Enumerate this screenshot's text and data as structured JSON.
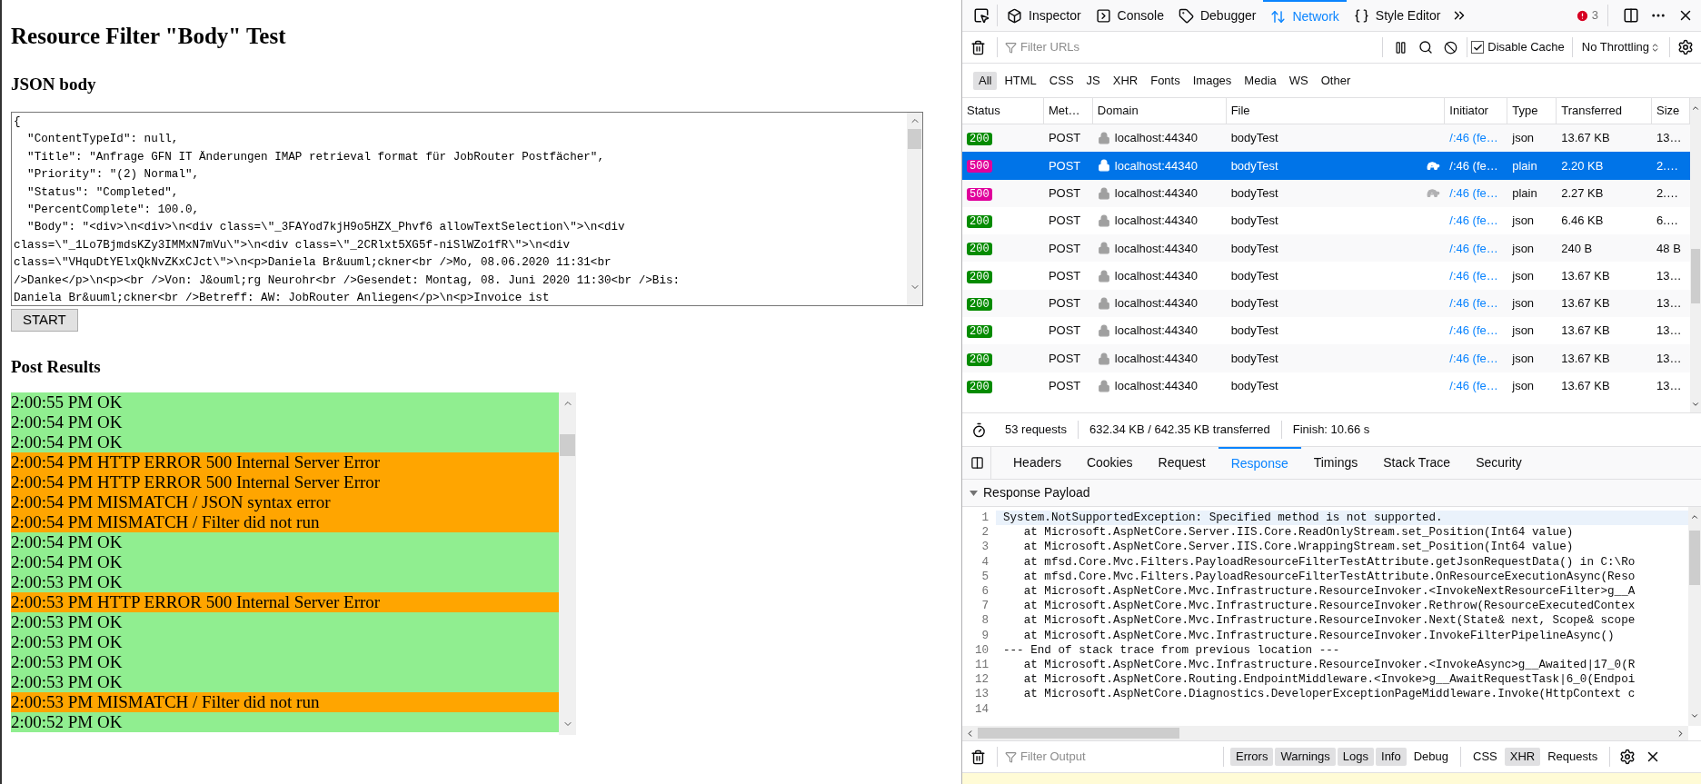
{
  "page": {
    "title": "Resource Filter \"Body\" Test",
    "body_heading": "JSON body",
    "json_body": [
      "{",
      "  \"ContentTypeId\": null,",
      "  \"Title\": \"Anfrage GFN IT Änderungen IMAP retrieval format für JobRouter Postfächer\",",
      "  \"Priority\": \"(2) Normal\",",
      "  \"Status\": \"Completed\",",
      "  \"PercentComplete\": 100.0,",
      "  \"Body\": \"<div>\\n<div>\\n<div class=\\\"_3FAYod7kjH9o5HZX_Phvf6 allowTextSelection\\\">\\n<div",
      "class=\\\"_1Lo7BjmdsKZy3IMMxN7mVu\\\">\\n<div class=\\\"_2CRlxt5XG5f-niSlWZo1fR\\\">\\n<div",
      "class=\\\"VHquDtYElxQkNvZKxCJct\\\">\\n<p>Daniela Br&uuml;ckner<br />Mo, 08.06.2020 11:31<br",
      "/>Danke</p>\\n<p><br />Von: J&ouml;rg Neurohr<br />Gesendet: Montag, 08. Juni 2020 11:30<br />Bis:",
      "Daniela Br&uuml;ckner<br />Betreff: AW: JobRouter Anliegen</p>\\n<p>Invoice ist"
    ],
    "start_button": "START",
    "results_heading": "Post Results",
    "results": [
      {
        "text": "2:00:55 PM OK",
        "kind": "ok"
      },
      {
        "text": "2:00:54 PM OK",
        "kind": "ok"
      },
      {
        "text": "2:00:54 PM OK",
        "kind": "ok"
      },
      {
        "text": "2:00:54 PM HTTP ERROR 500 Internal Server Error",
        "kind": "error"
      },
      {
        "text": "2:00:54 PM HTTP ERROR 500 Internal Server Error",
        "kind": "error"
      },
      {
        "text": "2:00:54 PM MISMATCH / JSON syntax error",
        "kind": "error"
      },
      {
        "text": "2:00:54 PM MISMATCH / Filter did not run",
        "kind": "error"
      },
      {
        "text": "2:00:54 PM OK",
        "kind": "ok"
      },
      {
        "text": "2:00:54 PM OK",
        "kind": "ok"
      },
      {
        "text": "2:00:53 PM OK",
        "kind": "ok"
      },
      {
        "text": "2:00:53 PM HTTP ERROR 500 Internal Server Error",
        "kind": "error"
      },
      {
        "text": "2:00:53 PM OK",
        "kind": "ok"
      },
      {
        "text": "2:00:53 PM OK",
        "kind": "ok"
      },
      {
        "text": "2:00:53 PM OK",
        "kind": "ok"
      },
      {
        "text": "2:00:53 PM OK",
        "kind": "ok"
      },
      {
        "text": "2:00:53 PM MISMATCH / Filter did not run",
        "kind": "error"
      },
      {
        "text": "2:00:52 PM OK",
        "kind": "ok"
      }
    ]
  },
  "devtools": {
    "tabs": [
      {
        "label": "Inspector",
        "kind": "inspector",
        "selected": false
      },
      {
        "label": "Console",
        "kind": "console",
        "selected": false
      },
      {
        "label": "Debugger",
        "kind": "debugger",
        "selected": false
      },
      {
        "label": "Network",
        "kind": "network",
        "selected": true
      },
      {
        "label": "Style Editor",
        "kind": "style",
        "selected": false
      }
    ],
    "error_count": "3",
    "filter_placeholder": "Filter URLs",
    "disable_cache": {
      "label": "Disable Cache",
      "checked": true
    },
    "throttling": "No Throttling",
    "type_filters": [
      {
        "label": "All",
        "selected": true
      },
      {
        "label": "HTML",
        "selected": false
      },
      {
        "label": "CSS",
        "selected": false
      },
      {
        "label": "JS",
        "selected": false
      },
      {
        "label": "XHR",
        "selected": false
      },
      {
        "label": "Fonts",
        "selected": false
      },
      {
        "label": "Images",
        "selected": false
      },
      {
        "label": "Media",
        "selected": false
      },
      {
        "label": "WS",
        "selected": false
      },
      {
        "label": "Other",
        "selected": false
      }
    ],
    "columns": [
      "Status",
      "Met…",
      "Domain",
      "File",
      "Initiator",
      "Type",
      "Transferred",
      "Size"
    ],
    "rows": [
      {
        "status": "200",
        "method": "POST",
        "domain": "localhost:44340",
        "file": "bodyTest",
        "initiator": "/:46 (fe…",
        "type": "json",
        "transferred": "13.67 KB",
        "size": "13…",
        "selected": false,
        "slow": false
      },
      {
        "status": "500",
        "method": "POST",
        "domain": "localhost:44340",
        "file": "bodyTest",
        "initiator": "/:46 (fe…",
        "type": "plain",
        "transferred": "2.20 KB",
        "size": "2.…",
        "selected": true,
        "slow": true
      },
      {
        "status": "500",
        "method": "POST",
        "domain": "localhost:44340",
        "file": "bodyTest",
        "initiator": "/:46 (fe…",
        "type": "plain",
        "transferred": "2.27 KB",
        "size": "2.…",
        "selected": false,
        "slow": true
      },
      {
        "status": "200",
        "method": "POST",
        "domain": "localhost:44340",
        "file": "bodyTest",
        "initiator": "/:46 (fe…",
        "type": "json",
        "transferred": "6.46 KB",
        "size": "6.…",
        "selected": false,
        "slow": false
      },
      {
        "status": "200",
        "method": "POST",
        "domain": "localhost:44340",
        "file": "bodyTest",
        "initiator": "/:46 (fe…",
        "type": "json",
        "transferred": "240 B",
        "size": "48 B",
        "selected": false,
        "slow": false
      },
      {
        "status": "200",
        "method": "POST",
        "domain": "localhost:44340",
        "file": "bodyTest",
        "initiator": "/:46 (fe…",
        "type": "json",
        "transferred": "13.67 KB",
        "size": "13…",
        "selected": false,
        "slow": false
      },
      {
        "status": "200",
        "method": "POST",
        "domain": "localhost:44340",
        "file": "bodyTest",
        "initiator": "/:46 (fe…",
        "type": "json",
        "transferred": "13.67 KB",
        "size": "13…",
        "selected": false,
        "slow": false
      },
      {
        "status": "200",
        "method": "POST",
        "domain": "localhost:44340",
        "file": "bodyTest",
        "initiator": "/:46 (fe…",
        "type": "json",
        "transferred": "13.67 KB",
        "size": "13…",
        "selected": false,
        "slow": false
      },
      {
        "status": "200",
        "method": "POST",
        "domain": "localhost:44340",
        "file": "bodyTest",
        "initiator": "/:46 (fe…",
        "type": "json",
        "transferred": "13.67 KB",
        "size": "13…",
        "selected": false,
        "slow": false
      },
      {
        "status": "200",
        "method": "POST",
        "domain": "localhost:44340",
        "file": "bodyTest",
        "initiator": "/:46 (fe…",
        "type": "json",
        "transferred": "13.67 KB",
        "size": "13…",
        "selected": false,
        "slow": false
      }
    ],
    "summary": [
      "53 requests",
      "632.34 KB / 642.35 KB transferred",
      "Finish: 10.66 s"
    ],
    "detail_tabs": [
      {
        "label": "Headers",
        "selected": false
      },
      {
        "label": "Cookies",
        "selected": false
      },
      {
        "label": "Request",
        "selected": false
      },
      {
        "label": "Response",
        "selected": true
      },
      {
        "label": "Timings",
        "selected": false
      },
      {
        "label": "Stack Trace",
        "selected": false
      },
      {
        "label": "Security",
        "selected": false
      }
    ],
    "payload_heading": "Response Payload",
    "payload_lines": [
      {
        "number": "1",
        "text": "System.NotSupportedException: Specified method is not supported."
      },
      {
        "number": "2",
        "text": "   at Microsoft.AspNetCore.Server.IIS.Core.ReadOnlyStream.set_Position(Int64 value)"
      },
      {
        "number": "3",
        "text": "   at Microsoft.AspNetCore.Server.IIS.Core.WrappingStream.set_Position(Int64 value)"
      },
      {
        "number": "4",
        "text": "   at mfsd.Core.Mvc.Filters.PayloadResourceFilterTestAttribute.getJsonRequestData() in C:\\Ro"
      },
      {
        "number": "5",
        "text": "   at mfsd.Core.Mvc.Filters.PayloadResourceFilterTestAttribute.OnResourceExecutionAsync(Reso"
      },
      {
        "number": "6",
        "text": "   at Microsoft.AspNetCore.Mvc.Infrastructure.ResourceInvoker.<InvokeNextResourceFilter>g__A"
      },
      {
        "number": "7",
        "text": "   at Microsoft.AspNetCore.Mvc.Infrastructure.ResourceInvoker.Rethrow(ResourceExecutedContex"
      },
      {
        "number": "8",
        "text": "   at Microsoft.AspNetCore.Mvc.Infrastructure.ResourceInvoker.Next(State& next, Scope& scope"
      },
      {
        "number": "9",
        "text": "   at Microsoft.AspNetCore.Mvc.Infrastructure.ResourceInvoker.InvokeFilterPipelineAsync()"
      },
      {
        "number": "10",
        "text": "--- End of stack trace from previous location ---"
      },
      {
        "number": "11",
        "text": "   at Microsoft.AspNetCore.Mvc.Infrastructure.ResourceInvoker.<InvokeAsync>g__Awaited|17_0(R"
      },
      {
        "number": "12",
        "text": "   at Microsoft.AspNetCore.Routing.EndpointMiddleware.<Invoke>g__AwaitRequestTask|6_0(Endpoi"
      },
      {
        "number": "13",
        "text": "   at Microsoft.AspNetCore.Diagnostics.DeveloperExceptionPageMiddleware.Invoke(HttpContext c"
      },
      {
        "number": "14"
      }
    ],
    "console": {
      "filter_placeholder": "Filter Output",
      "levels": [
        {
          "label": "Errors",
          "selected": true
        },
        {
          "label": "Warnings",
          "selected": true
        },
        {
          "label": "Logs",
          "selected": true
        },
        {
          "label": "Info",
          "selected": true
        },
        {
          "label": "Debug",
          "selected": false
        }
      ],
      "extras": [
        {
          "label": "CSS",
          "selected": false
        },
        {
          "label": "XHR",
          "selected": true
        },
        {
          "label": "Requests",
          "selected": false
        }
      ]
    }
  }
}
